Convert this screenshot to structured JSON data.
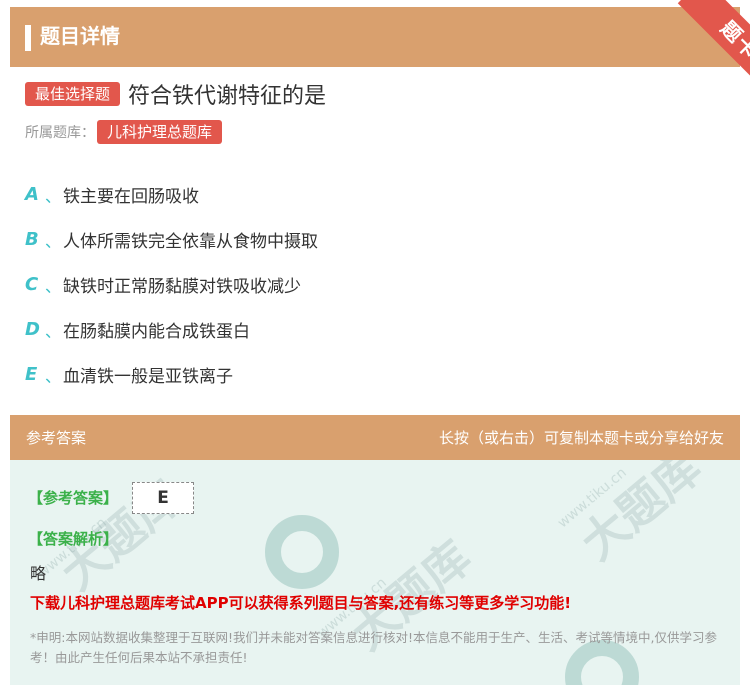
{
  "header": {
    "title": "题目详情",
    "ribbon_label": "题卡"
  },
  "question": {
    "type_tag": "最佳选择题",
    "text": "符合铁代谢特征的是",
    "bank_label": "所属题库：",
    "bank_name": "儿科护理总题库"
  },
  "options": [
    {
      "letter": "A",
      "sep": "、",
      "text": "铁主要在回肠吸收"
    },
    {
      "letter": "B",
      "sep": "、",
      "text": "人体所需铁完全依靠从食物中摄取"
    },
    {
      "letter": "C",
      "sep": "、",
      "text": "缺铁时正常肠黏膜对铁吸收减少"
    },
    {
      "letter": "D",
      "sep": "、",
      "text": "在肠黏膜内能合成铁蛋白"
    },
    {
      "letter": "E",
      "sep": "、",
      "text": "血清铁一般是亚铁离子"
    }
  ],
  "answer": {
    "section_title": "参考答案",
    "copy_hint": "长按（或右击）可复制本题卡或分享给好友",
    "ref_label": "【参考答案】",
    "ref_value": "E",
    "analysis_label": "【答案解析】",
    "analysis_text": "略",
    "promo_text": "下载儿科护理总题库考试APP可以获得系列题目与答案,还有练习等更多学习功能!",
    "disclaimer": "*申明:本网站数据收集整理于互联网!我们并未能对答案信息进行核对!本信息不能用于生产、生活、考试等情境中,仅供学习参考！由此产生任何后果本站不承担责任!"
  },
  "colors": {
    "header_bg": "#d9a06e",
    "tag_red": "#e2574c",
    "option_letter": "#3fc1c9",
    "answer_bg": "#e8f4f1",
    "label_green": "#3bb14a",
    "promo_red": "#e00000"
  }
}
